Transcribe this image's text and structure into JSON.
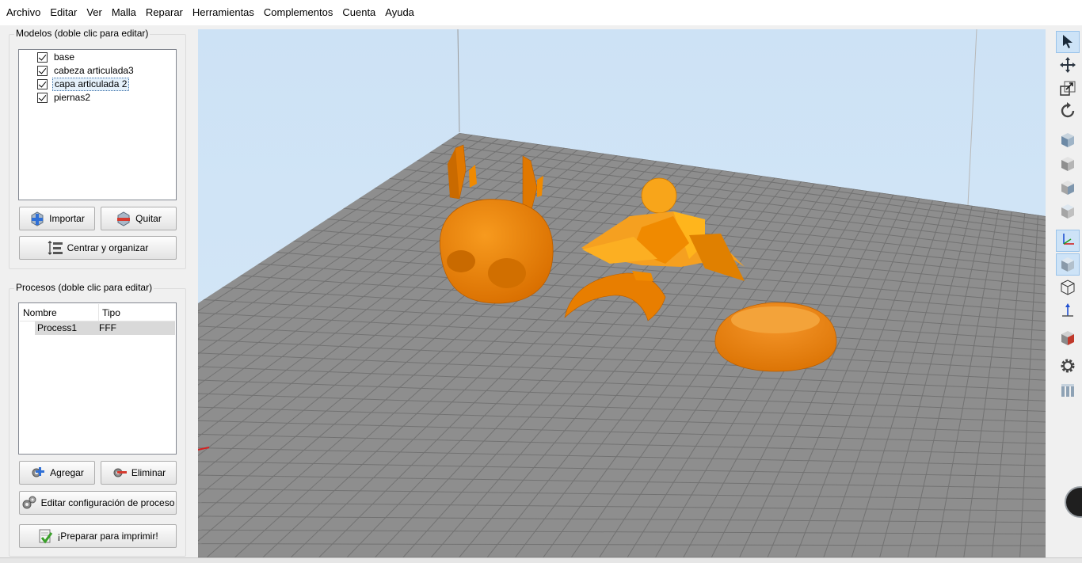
{
  "menu": [
    "Archivo",
    "Editar",
    "Ver",
    "Malla",
    "Reparar",
    "Herramientas",
    "Complementos",
    "Cuenta",
    "Ayuda"
  ],
  "models_panel": {
    "title": "Modelos (doble clic para editar)",
    "items": [
      {
        "label": "base",
        "checked": true,
        "selected": false
      },
      {
        "label": "cabeza articulada3",
        "checked": true,
        "selected": false
      },
      {
        "label": "capa articulada 2",
        "checked": true,
        "selected": true
      },
      {
        "label": "piernas2",
        "checked": true,
        "selected": false
      }
    ],
    "import_label": "Importar",
    "remove_label": "Quitar",
    "center_label": "Centrar y organizar"
  },
  "process_panel": {
    "title": "Procesos (doble clic para editar)",
    "columns": [
      "Nombre",
      "Tipo"
    ],
    "rows": [
      {
        "name": "Process1",
        "type": "FFF"
      }
    ],
    "add_label": "Agregar",
    "delete_label": "Eliminar",
    "edit_label": "Editar configuración de proceso",
    "prepare_label": "¡Preparar para imprimir!"
  },
  "colors": {
    "accent": "#3a6ea5",
    "model": "#f08a00",
    "bed": "#8a8a8a",
    "sky": "#cfe3f5"
  },
  "right_toolbar": [
    "select-icon",
    "move-icon",
    "scale-icon",
    "rotate-icon",
    "view-iso-icon",
    "view-front-icon",
    "view-side-icon",
    "view-top-icon",
    "axes-icon",
    "solid-view-icon",
    "wireframe-view-icon",
    "normals-icon",
    "cross-section-icon",
    "settings-gear-icon",
    "layers-icon"
  ]
}
